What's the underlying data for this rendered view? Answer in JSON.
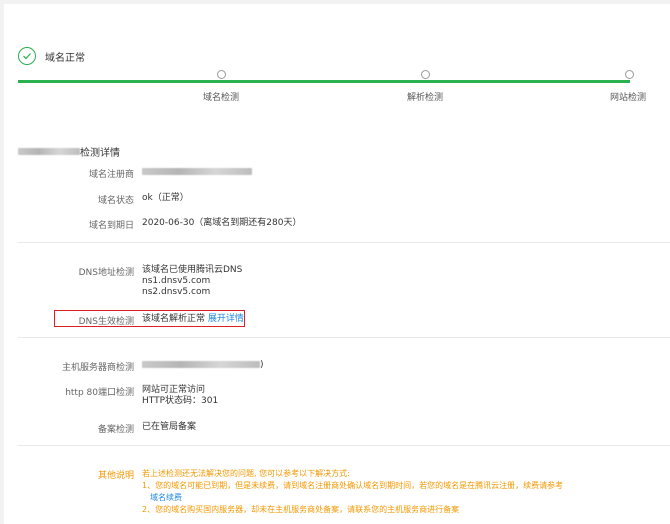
{
  "status": {
    "text": "域名正常",
    "icon": "check-circle-icon",
    "color": "#2bb14e"
  },
  "steps": [
    {
      "label": "域名检测"
    },
    {
      "label": "解析检测"
    },
    {
      "label": "网站检测"
    }
  ],
  "details": {
    "title_suffix": "检测详情",
    "registrar": {
      "label": "域名注册商"
    },
    "domain_status": {
      "label": "域名状态",
      "value": "ok（正常）"
    },
    "expiry": {
      "label": "域名到期日",
      "value": "2020-06-30（离域名到期还有280天）"
    }
  },
  "dns": {
    "address": {
      "label": "DNS地址检测",
      "lines": [
        "该域名已使用腾讯云DNS",
        "ns1.dnsv5.com",
        "ns2.dnsv5.com"
      ]
    },
    "effective": {
      "label": "DNS生效检测",
      "value": "该域名解析正常",
      "link": "展开详情"
    }
  },
  "host": {
    "provider": {
      "label": "主机服务器商检测",
      "suffix": ")"
    },
    "http": {
      "label": "http 80端口检测",
      "lines": [
        "网站可正常访问",
        "HTTP状态码：301"
      ]
    },
    "icp": {
      "label": "备案检测",
      "value": "已在管局备案"
    }
  },
  "other": {
    "label": "其他说明",
    "intro": "若上述检测还无法解决您的问题, 您可以参考以下解决方式:",
    "item1": "1、您的域名可能已到期，但是未续费，请到域名注册商处确认域名到期时间，若您的域名是在腾讯云注册，续费请参考",
    "item1_link": "域名续费",
    "item2": "2、您的域名购买国内服务器，却未在主机服务商处备案，请联系您的主机服务商进行备案"
  },
  "colors": {
    "accent_green": "#2bb14e",
    "highlight_red": "#e02020",
    "link_blue": "#1e88e5",
    "note_orange": "#f39800"
  }
}
